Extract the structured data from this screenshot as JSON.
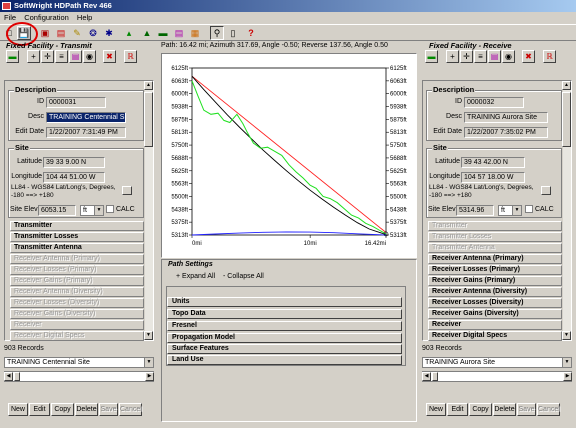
{
  "window": {
    "title": "SoftWright HDPath Rev 466"
  },
  "menu": [
    "File",
    "Configuration",
    "Help"
  ],
  "toolbar_icons": [
    "new-icon",
    "save-icon",
    "open-icon",
    "edit-icon",
    "properties-icon",
    "compass-icon",
    "antenna-icon",
    "map-icon",
    "terrain-icon",
    "profile-icon",
    "chart-icon",
    "zoom-icon",
    "page-icon",
    "help-icon"
  ],
  "path_info": "Path: 16.42 mi; Azimuth 317.69, Angle -0.50; Reverse 137.56, Angle 0.50",
  "left": {
    "title": "Fixed Facility - Transmit",
    "desc_group": "Description",
    "id_label": "ID",
    "id": "0000031",
    "desc_label": "Desc",
    "desc": "TRAINING Centennial Site",
    "edit_label": "Edit Date",
    "edit_date": "1/22/2007 7:31:49 PM",
    "site_group": "Site",
    "lat_label": "Latitude",
    "lat": "39 33 9.00 N",
    "lon_label": "Longitude",
    "lon": "104 44 51.00 W",
    "datum": "LL84 - WGS84 Lat/Long's, Degrees, -180 ==> +180",
    "elev_label": "Site Elev",
    "elev": "6053.15",
    "unit": "ft",
    "calc": "CALC",
    "sections": [
      {
        "label": "Transmitter",
        "enabled": true
      },
      {
        "label": "Transmitter Losses",
        "enabled": true
      },
      {
        "label": "Transmitter Antenna",
        "enabled": true
      },
      {
        "label": "Receiver Antenna (Primary)",
        "enabled": false
      },
      {
        "label": "Receiver Losses (Primary)",
        "enabled": false
      },
      {
        "label": "Receiver Gains (Primary)",
        "enabled": false
      },
      {
        "label": "Receiver Antenna (Diversity)",
        "enabled": false
      },
      {
        "label": "Receiver Losses (Diversity)",
        "enabled": false
      },
      {
        "label": "Receiver Gains (Diversity)",
        "enabled": false
      },
      {
        "label": "Receiver",
        "enabled": false
      },
      {
        "label": "Receiver Digital Specs",
        "enabled": false
      }
    ],
    "records": "903 Records",
    "selected": "TRAINING Centennial Site"
  },
  "right": {
    "title": "Fixed Facility - Receive",
    "desc_group": "Description",
    "id_label": "ID",
    "id": "0000032",
    "desc_label": "Desc",
    "desc": "TRAINING Aurora Site",
    "edit_label": "Edit Date",
    "edit_date": "1/22/2007 7:35:02 PM",
    "site_group": "Site",
    "lat_label": "Latitude",
    "lat": "39 43 42.00 N",
    "lon_label": "Longitude",
    "lon": "104 57 18.00 W",
    "datum": "LL84 - WGS84 Lat/Long's, Degrees, -180 ==> +180",
    "elev_label": "Site Elev",
    "elev": "5314.96",
    "unit": "ft",
    "calc": "CALC",
    "sections": [
      {
        "label": "Transmitter",
        "enabled": false
      },
      {
        "label": "Transmitter Losses",
        "enabled": false
      },
      {
        "label": "Transmitter Antenna",
        "enabled": false
      },
      {
        "label": "Receiver Antenna (Primary)",
        "enabled": true
      },
      {
        "label": "Receiver Losses (Primary)",
        "enabled": true
      },
      {
        "label": "Receiver Gains (Primary)",
        "enabled": true
      },
      {
        "label": "Receiver Antenna (Diversity)",
        "enabled": true
      },
      {
        "label": "Receiver Losses (Diversity)",
        "enabled": true
      },
      {
        "label": "Receiver Gains (Diversity)",
        "enabled": true
      },
      {
        "label": "Receiver",
        "enabled": true
      },
      {
        "label": "Receiver Digital Specs",
        "enabled": true
      }
    ],
    "records": "903 Records",
    "selected": "TRAINING Aurora Site"
  },
  "bottom_buttons": [
    {
      "label": "New",
      "enabled": true
    },
    {
      "label": "Edit",
      "enabled": true
    },
    {
      "label": "Copy",
      "enabled": true
    },
    {
      "label": "Delete",
      "enabled": true
    },
    {
      "label": "Save",
      "enabled": false
    },
    {
      "label": "Cancel",
      "enabled": false
    }
  ],
  "path_settings": {
    "title": "Path Settings",
    "expand": "+ Expand All",
    "collapse": "- Collapse All",
    "items": [
      "Units",
      "Topo Data",
      "Fresnel",
      "Propagation Model",
      "Surface Features",
      "Land Use"
    ]
  },
  "chart_data": {
    "type": "line",
    "ylim": [
      5313,
      6125
    ],
    "xlim": [
      0,
      16.42
    ],
    "y_ticks": [
      "6125ft",
      "6063ft",
      "6000ft",
      "5938ft",
      "5875ft",
      "5813ft",
      "5750ft",
      "5688ft",
      "5625ft",
      "5563ft",
      "5500ft",
      "5438ft",
      "5375ft",
      "5313ft"
    ],
    "x_ticks": [
      "0mi",
      "10mi",
      "16.42mi"
    ],
    "series": [
      {
        "color": "#ff2020",
        "x": [
          0,
          16.42
        ],
        "y": [
          6085,
          5325
        ]
      },
      {
        "color": "#000000",
        "x": [
          0,
          1,
          2,
          3,
          4,
          5,
          6,
          7,
          8,
          9,
          10,
          11,
          12,
          13,
          14,
          15,
          16.42
        ],
        "y": [
          6085,
          6020,
          5958,
          5897,
          5838,
          5782,
          5727,
          5675,
          5625,
          5577,
          5531,
          5488,
          5447,
          5409,
          5373,
          5342,
          5315
        ]
      },
      {
        "color": "#20e020",
        "x": [
          0,
          0.5,
          1,
          1.6,
          2.2,
          2.7,
          3.2,
          3.8,
          4.3,
          4.7,
          5.2,
          5.8,
          6.4,
          7.0,
          7.6,
          8.2,
          8.8,
          9.4,
          10.0,
          10.5,
          11.1,
          11.7,
          12.3,
          12.9,
          13.5,
          14.1,
          14.7,
          15.3,
          15.9,
          16.42
        ],
        "y": [
          6063,
          5990,
          5920,
          5900,
          5905,
          5870,
          5860,
          5900,
          5855,
          5810,
          5760,
          5735,
          5740,
          5720,
          5700,
          5655,
          5620,
          5590,
          5555,
          5540,
          5500,
          5490,
          5470,
          5440,
          5410,
          5395,
          5370,
          5355,
          5335,
          5318
        ]
      },
      {
        "color": "#2020ff",
        "x": [
          0,
          2,
          4,
          6,
          8,
          10,
          12,
          14,
          16.42
        ],
        "y": [
          5313,
          5318,
          5322,
          5326,
          5328,
          5327,
          5324,
          5319,
          5313
        ]
      }
    ]
  }
}
